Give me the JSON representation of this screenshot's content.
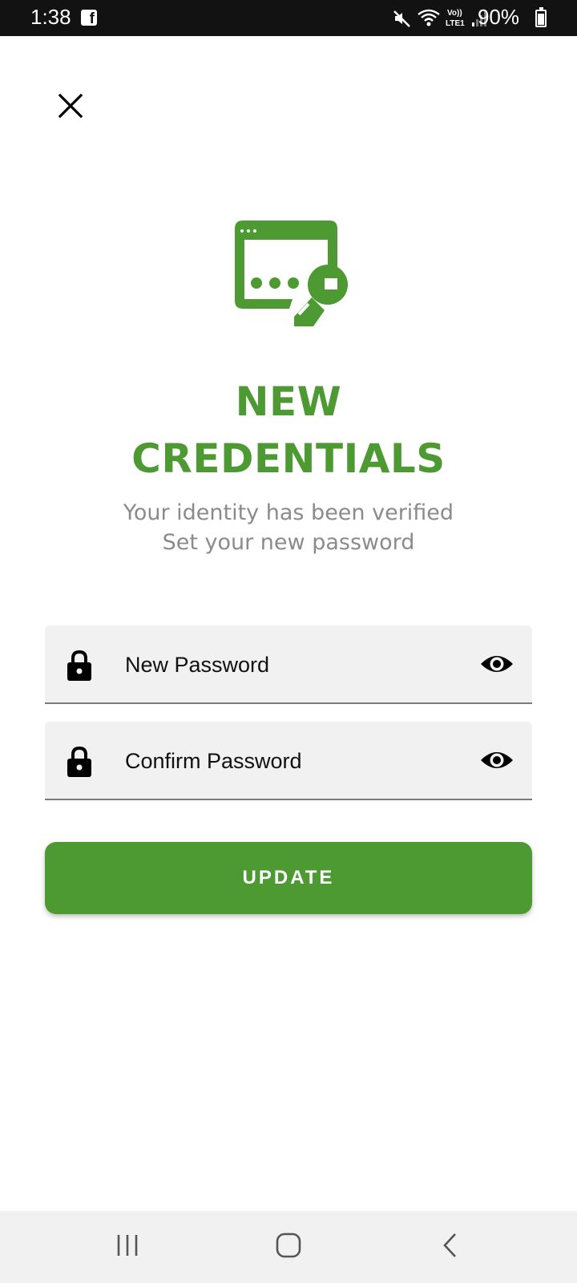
{
  "status_bar": {
    "time": "1:38",
    "battery": "90%",
    "icons": [
      "facebook-icon",
      "mute-icon",
      "wifi-icon",
      "volte-lte1-icon",
      "signal-icon",
      "battery-charging-icon"
    ]
  },
  "header": {
    "close_icon": "close-icon"
  },
  "hero": {
    "icon": "password-key-icon",
    "title_line1": "NEW",
    "title_line2": "CREDENTIALS",
    "subtitle_line1": "Your identity has been verified",
    "subtitle_line2": "Set your new password"
  },
  "form": {
    "new_password": {
      "placeholder": "New Password",
      "value": "",
      "icon": "lock-icon",
      "toggle_icon": "eye-icon"
    },
    "confirm_password": {
      "placeholder": "Confirm Password",
      "value": "",
      "icon": "lock-icon",
      "toggle_icon": "eye-icon"
    },
    "update_label": "UPDATE"
  },
  "nav_bar": {
    "buttons": [
      "recents-icon",
      "home-icon",
      "back-icon"
    ]
  },
  "colors": {
    "accent": "#4d9a33",
    "status_bar": "#121212",
    "field_bg": "#f1f1f1",
    "subtitle": "#8b8b8b"
  }
}
